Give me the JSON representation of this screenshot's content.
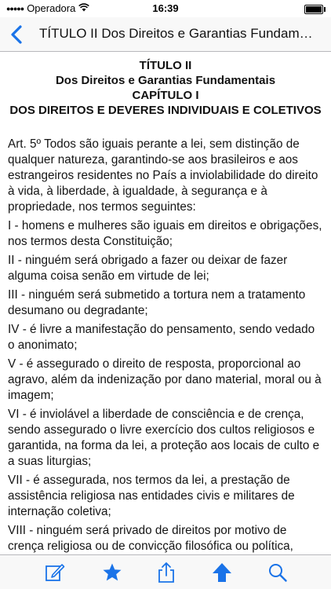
{
  "status_bar": {
    "carrier": "Operadora",
    "time": "16:39"
  },
  "nav": {
    "title": "TÍTULO II Dos Direitos e Garantias Fundamentais"
  },
  "heading": {
    "line1": "TÍTULO II",
    "line2": "Dos Direitos e Garantias Fundamentais",
    "line3": "CAPÍTULO I",
    "line4": "DOS DIREITOS E DEVERES INDIVIDUAIS E COLETIVOS"
  },
  "article": {
    "paragraphs": [
      "Art. 5º Todos são iguais perante a lei, sem distinção de qualquer natureza, garantindo-se aos brasileiros e aos estrangeiros residentes no País a inviolabilidade do direito à vida, à liberdade, à igualdade, à segurança e à propriedade, nos termos seguintes:",
      "I - homens e mulheres são iguais em direitos e obrigações, nos termos desta Constituição;",
      "II - ninguém será obrigado a fazer ou deixar de fazer alguma coisa senão em virtude de lei;",
      "III - ninguém será submetido a tortura nem a tratamento desumano ou degradante;",
      "IV - é livre a manifestação do pensamento, sendo vedado o anonimato;",
      "V - é assegurado o direito de resposta, proporcional ao agravo, além da indenização por dano material, moral ou à imagem;",
      "VI - é inviolável a liberdade de consciência e de crença, sendo assegurado o livre exercício dos cultos religiosos e garantida, na forma da lei, a proteção aos locais de culto e a suas liturgias;",
      "VII - é assegurada, nos termos da lei, a prestação de assistência religiosa nas entidades civis e militares de internação coletiva;",
      "VIII - ninguém será privado de direitos por motivo de crença religiosa ou de convicção filosófica ou política, salvo se as"
    ]
  },
  "toolbar": {
    "icons": [
      "edit-note-icon",
      "star-icon",
      "share-icon",
      "arrow-up-icon",
      "search-icon"
    ],
    "accent_color": "#1a73e8"
  }
}
